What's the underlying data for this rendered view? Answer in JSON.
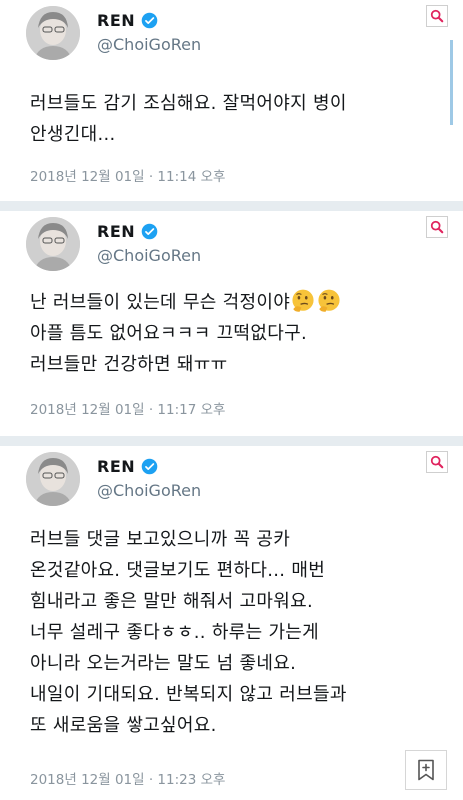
{
  "tweets": [
    {
      "name": "REN",
      "handle": "@ChoiGoRen",
      "lines": [
        "러브들도 감기 조심해요. 잘먹어야지 병이",
        "안생긴대..."
      ],
      "timestamp": "2018년 12월 01일 · 11:14 오후"
    },
    {
      "name": "REN",
      "handle": "@ChoiGoRen",
      "lines": [
        "난 러브들이 있는데 무슨 걱정이야",
        "아플 틈도 없어요ㅋㅋㅋ 끄떡없다구.",
        "러브들만 건강하면 돼ㅠㅠ"
      ],
      "timestamp": "2018년 12월 01일 · 11:17 오후"
    },
    {
      "name": "REN",
      "handle": "@ChoiGoRen",
      "lines": [
        "러브들 댓글 보고있으니까 꼭 공카",
        "온것같아요. 댓글보기도 편하다... 매번",
        "힘내라고 좋은 말만 해줘서 고마워요.",
        "너무 설레구 좋다ㅎㅎ.. 하루는 가는게",
        "아니라 오는거라는 말도 넘 좋네요.",
        "내일이 기대되요. 반복되지 않고 러브들과",
        "또 새로움을 쌓고싶어요."
      ],
      "timestamp": "2018년 12월 01일 · 11:23 오후"
    }
  ],
  "icons": {
    "verified": "verified-badge-icon",
    "search": "search-icon",
    "bookmark": "bookmark-add-icon",
    "emoji": "thinking-face-icon"
  },
  "colors": {
    "verified_blue": "#1da1f2",
    "search_red": "#e0245e",
    "meta_gray": "#8a959e",
    "divider": "#e6ecf0"
  }
}
